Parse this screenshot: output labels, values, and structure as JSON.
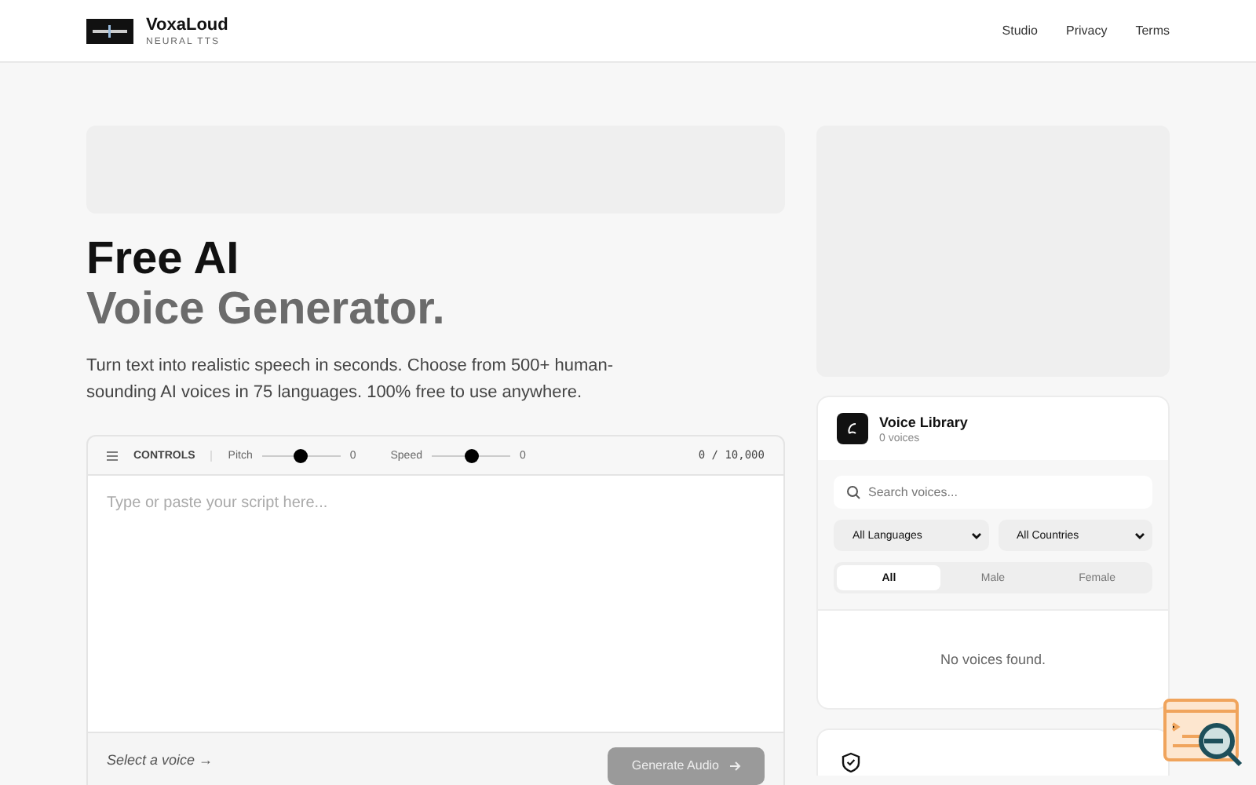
{
  "header": {
    "brand": "VoxaLoud",
    "tagline": "NEURAL TTS",
    "nav": [
      "Studio",
      "Privacy",
      "Terms"
    ]
  },
  "hero": {
    "title_line1": "Free AI",
    "title_line2": "Voice Generator.",
    "description": "Turn text into realistic speech in seconds. Choose from 500+ human-sounding AI voices in 75 languages. 100% free to use anywhere."
  },
  "editor": {
    "controls_label": "CONTROLS",
    "sliders": [
      {
        "label": "Pitch",
        "level": 0.5,
        "reading": "0"
      },
      {
        "label": "Speed",
        "level": 0.5,
        "reading": "0"
      }
    ],
    "counter": "0 / 10,000",
    "placeholder": "Type or paste your script here...",
    "hint": "Select a voice →",
    "generate": {
      "label": "Generate Audio",
      "disabled": true
    }
  },
  "voice_library": {
    "title": "Voice Library",
    "count": "0 voices",
    "search_placeholder": "Search voices...",
    "filters": [
      "All Languages",
      "All Countries"
    ],
    "tabs": [
      {
        "label": "All",
        "selected": true
      },
      {
        "label": "Male",
        "selected": false
      },
      {
        "label": "Female",
        "selected": false
      }
    ],
    "empty": "No voices found."
  }
}
